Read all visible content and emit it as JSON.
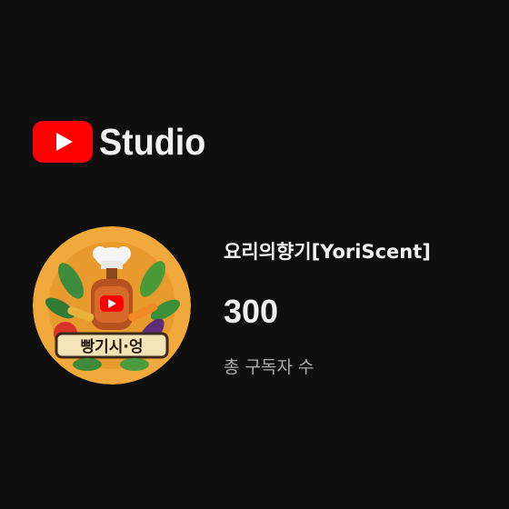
{
  "brand": {
    "logo_icon": "youtube-play-logo",
    "name": "Studio",
    "colors": {
      "logo_red": "#ff0000",
      "text": "#f1f1f1",
      "background": "#0f0f0f"
    }
  },
  "channel": {
    "avatar_icon": "channel-avatar-food-illustration",
    "avatar_text": "빵기시·엉",
    "name": "요리의향기[YoriScent]",
    "subscriber_count": "300",
    "subscriber_label": "총 구독자 수"
  }
}
